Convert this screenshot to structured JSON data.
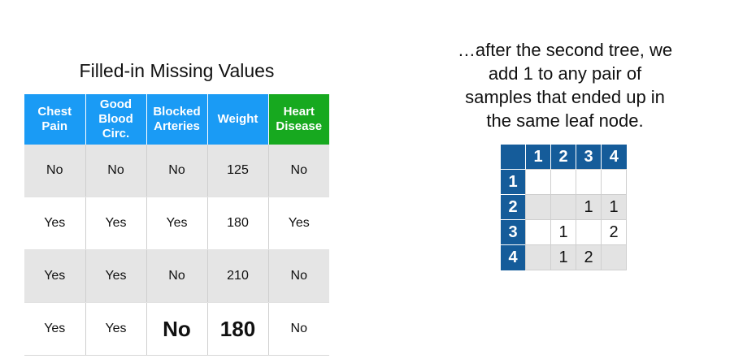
{
  "left_title": "Filled-in Missing Values",
  "table": {
    "headers": [
      {
        "lines": [
          "Chest",
          "Pain"
        ]
      },
      {
        "lines": [
          "Good",
          "Blood",
          "Circ."
        ]
      },
      {
        "lines": [
          "Blocked",
          "Arteries"
        ]
      },
      {
        "lines": [
          "Weight"
        ]
      },
      {
        "lines": [
          "Heart",
          "Disease"
        ]
      }
    ],
    "rows": [
      [
        "No",
        "No",
        "No",
        "125",
        "No"
      ],
      [
        "Yes",
        "Yes",
        "Yes",
        "180",
        "Yes"
      ],
      [
        "Yes",
        "Yes",
        "No",
        "210",
        "No"
      ],
      [
        "Yes",
        "Yes",
        "No",
        "180",
        "No"
      ]
    ]
  },
  "right_text": [
    "…after the second tree, we",
    "add 1 to any pair of",
    "samples that ended up in",
    "the same leaf node."
  ],
  "matrix": {
    "col_labels": [
      "1",
      "2",
      "3",
      "4"
    ],
    "row_labels": [
      "1",
      "2",
      "3",
      "4"
    ],
    "cells": [
      [
        "",
        "",
        "",
        ""
      ],
      [
        "",
        "",
        "1",
        "1"
      ],
      [
        "",
        "1",
        "",
        "2"
      ],
      [
        "",
        "1",
        "2",
        ""
      ]
    ]
  },
  "colors": {
    "header_blue": "#1a9bf5",
    "header_green": "#17a91f",
    "matrix_header": "#155c9a",
    "row_shade": "#e5e5e5"
  }
}
